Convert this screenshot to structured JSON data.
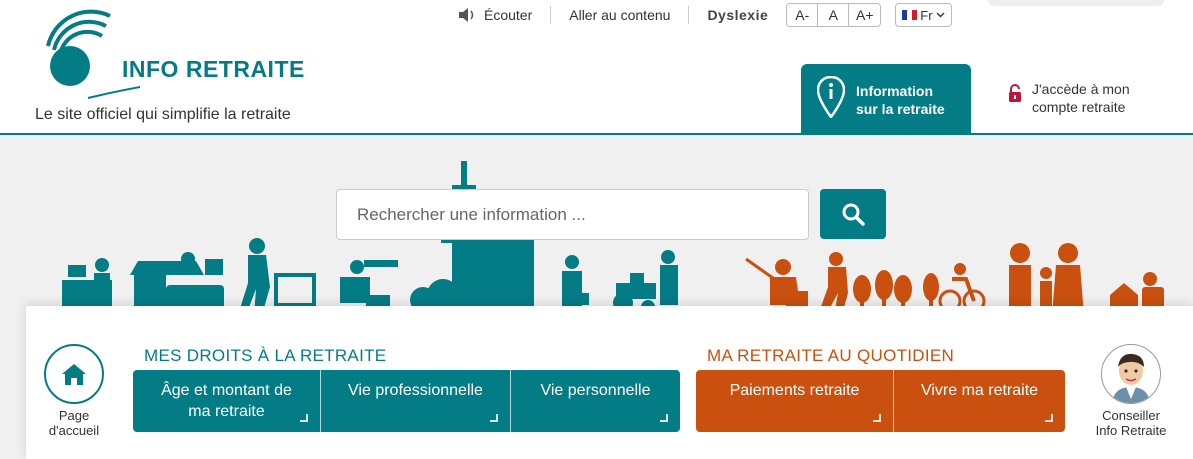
{
  "header": {
    "logo_text": "INFO RETRAITE",
    "tagline": "Le site officiel qui simplifie la retraite",
    "utility": {
      "listen_label": "Écouter",
      "skip_label": "Aller au contenu",
      "dyslexia_label": "Dyslexie",
      "font_smaller": "A-",
      "font_normal": "A",
      "font_larger": "A+",
      "language": "Fr"
    },
    "info_tab": {
      "line1": "Information",
      "line2": "sur la retraite"
    },
    "account": {
      "line1": "J'accède à mon",
      "line2": "compte retraite"
    }
  },
  "search": {
    "placeholder": "Rechercher une information ..."
  },
  "nav": {
    "home": {
      "line1": "Page",
      "line2": "d'accueil"
    },
    "rights_title": "MES DROITS À LA RETRAITE",
    "rights_buttons": [
      {
        "line1": "Âge et montant de",
        "line2": "ma retraite"
      },
      {
        "line1": "Vie professionnelle",
        "line2": ""
      },
      {
        "line1": "Vie personnelle",
        "line2": ""
      }
    ],
    "daily_title": "MA RETRAITE AU QUOTIDIEN",
    "daily_buttons": [
      {
        "line1": "Paiements retraite",
        "line2": ""
      },
      {
        "line1": "Vivre ma retraite",
        "line2": ""
      }
    ],
    "advisor": {
      "line1": "Conseiller",
      "line2": "Info Retraite"
    }
  },
  "colors": {
    "teal": "#047c86",
    "orange": "#c9500e",
    "account_lock": "#c0143c",
    "hero_bg": "#f0f0f0"
  },
  "icons": {
    "listen": "speaker-icon",
    "info": "location-info-icon",
    "lock": "lock-icon",
    "search": "search-icon",
    "home": "home-icon",
    "advisor": "advisor-avatar"
  }
}
